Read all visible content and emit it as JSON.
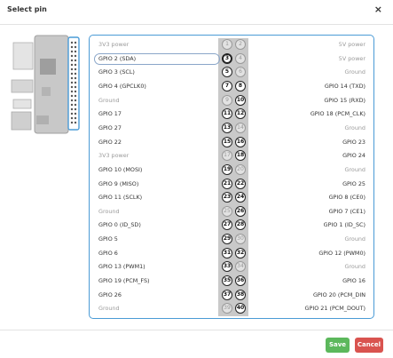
{
  "dialog": {
    "title": "Select pin",
    "close_glyph": "×"
  },
  "buttons": {
    "save": "Save",
    "cancel": "Cancel"
  },
  "colors": {
    "accent": "#4a9bd6",
    "save": "#5cb85c",
    "cancel": "#d9534f"
  },
  "selected_pin": 3,
  "rows": [
    {
      "left": "3V3 power",
      "odd": 1,
      "even": 2,
      "right": "5V power",
      "left_gpio": false,
      "right_gpio": false
    },
    {
      "left": "GPIO 2 (SDA)",
      "odd": 3,
      "even": 4,
      "right": "5V power",
      "left_gpio": true,
      "right_gpio": false
    },
    {
      "left": "GPIO 3 (SCL)",
      "odd": 5,
      "even": 6,
      "right": "Ground",
      "left_gpio": true,
      "right_gpio": false
    },
    {
      "left": "GPIO 4 (GPCLK0)",
      "odd": 7,
      "even": 8,
      "right": "GPIO 14 (TXD)",
      "left_gpio": true,
      "right_gpio": true
    },
    {
      "left": "Ground",
      "odd": 9,
      "even": 10,
      "right": "GPIO 15 (RXD)",
      "left_gpio": false,
      "right_gpio": true
    },
    {
      "left": "GPIO 17",
      "odd": 11,
      "even": 12,
      "right": "GPIO 18 (PCM_CLK)",
      "left_gpio": true,
      "right_gpio": true
    },
    {
      "left": "GPIO 27",
      "odd": 13,
      "even": 14,
      "right": "Ground",
      "left_gpio": true,
      "right_gpio": false
    },
    {
      "left": "GPIO 22",
      "odd": 15,
      "even": 16,
      "right": "GPIO 23",
      "left_gpio": true,
      "right_gpio": true
    },
    {
      "left": "3V3 power",
      "odd": 17,
      "even": 18,
      "right": "GPIO 24",
      "left_gpio": false,
      "right_gpio": true
    },
    {
      "left": "GPIO 10 (MOSI)",
      "odd": 19,
      "even": 20,
      "right": "Ground",
      "left_gpio": true,
      "right_gpio": false
    },
    {
      "left": "GPIO 9 (MISO)",
      "odd": 21,
      "even": 22,
      "right": "GPIO 25",
      "left_gpio": true,
      "right_gpio": true
    },
    {
      "left": "GPIO 11 (SCLK)",
      "odd": 23,
      "even": 24,
      "right": "GPIO 8 (CE0)",
      "left_gpio": true,
      "right_gpio": true
    },
    {
      "left": "Ground",
      "odd": 25,
      "even": 26,
      "right": "GPIO 7 (CE1)",
      "left_gpio": false,
      "right_gpio": true
    },
    {
      "left": "GPIO 0 (ID_SD)",
      "odd": 27,
      "even": 28,
      "right": "GPIO 1 (ID_SC)",
      "left_gpio": true,
      "right_gpio": true
    },
    {
      "left": "GPIO 5",
      "odd": 29,
      "even": 30,
      "right": "Ground",
      "left_gpio": true,
      "right_gpio": false
    },
    {
      "left": "GPIO 6",
      "odd": 31,
      "even": 32,
      "right": "GPIO 12 (PWM0)",
      "left_gpio": true,
      "right_gpio": true
    },
    {
      "left": "GPIO 13 (PWM1)",
      "odd": 33,
      "even": 34,
      "right": "Ground",
      "left_gpio": true,
      "right_gpio": false
    },
    {
      "left": "GPIO 19 (PCM_FS)",
      "odd": 35,
      "even": 36,
      "right": "GPIO 16",
      "left_gpio": true,
      "right_gpio": true
    },
    {
      "left": "GPIO 26",
      "odd": 37,
      "even": 38,
      "right": "GPIO 20 (PCM_DIN",
      "left_gpio": true,
      "right_gpio": true
    },
    {
      "left": "Ground",
      "odd": 39,
      "even": 40,
      "right": "GPIO 21 (PCM_DOUT)",
      "left_gpio": false,
      "right_gpio": true
    }
  ]
}
